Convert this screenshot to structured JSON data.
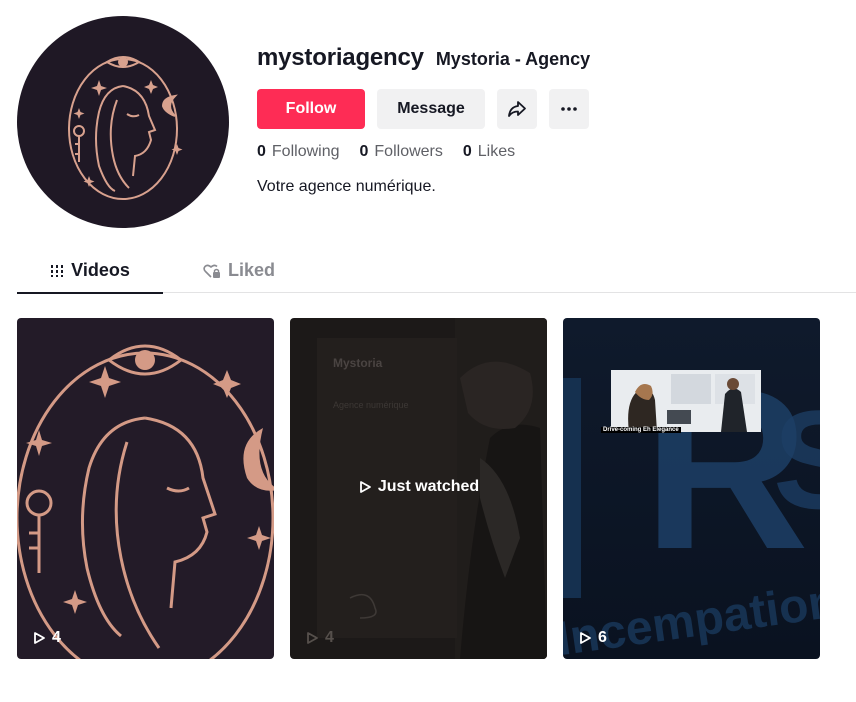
{
  "profile": {
    "username": "mystoriagency",
    "nickname": "Mystoria - Agency",
    "bio": "Votre agence numérique."
  },
  "buttons": {
    "follow": "Follow",
    "message": "Message",
    "share_icon": "share-icon",
    "more_icon": "more-icon"
  },
  "stats": [
    {
      "value": "0",
      "label": "Following"
    },
    {
      "value": "0",
      "label": "Followers"
    },
    {
      "value": "0",
      "label": "Likes"
    }
  ],
  "tabs": [
    {
      "label": "Videos",
      "icon": "grid-icon",
      "active": true
    },
    {
      "label": "Liked",
      "icon": "heart-lock-icon",
      "active": false
    }
  ],
  "videos": [
    {
      "views": "4",
      "overlay": ""
    },
    {
      "views": "4",
      "overlay": "Just watched",
      "brand": "Mystoria",
      "subbrand": "Agence numérique"
    },
    {
      "views": "6",
      "overlay": "",
      "caption": "Drive-coming Eh Elegance"
    }
  ],
  "colors": {
    "accent": "#fe2c55",
    "avatar_bg": "#1f1825",
    "avatar_line": "#d8a18e"
  }
}
